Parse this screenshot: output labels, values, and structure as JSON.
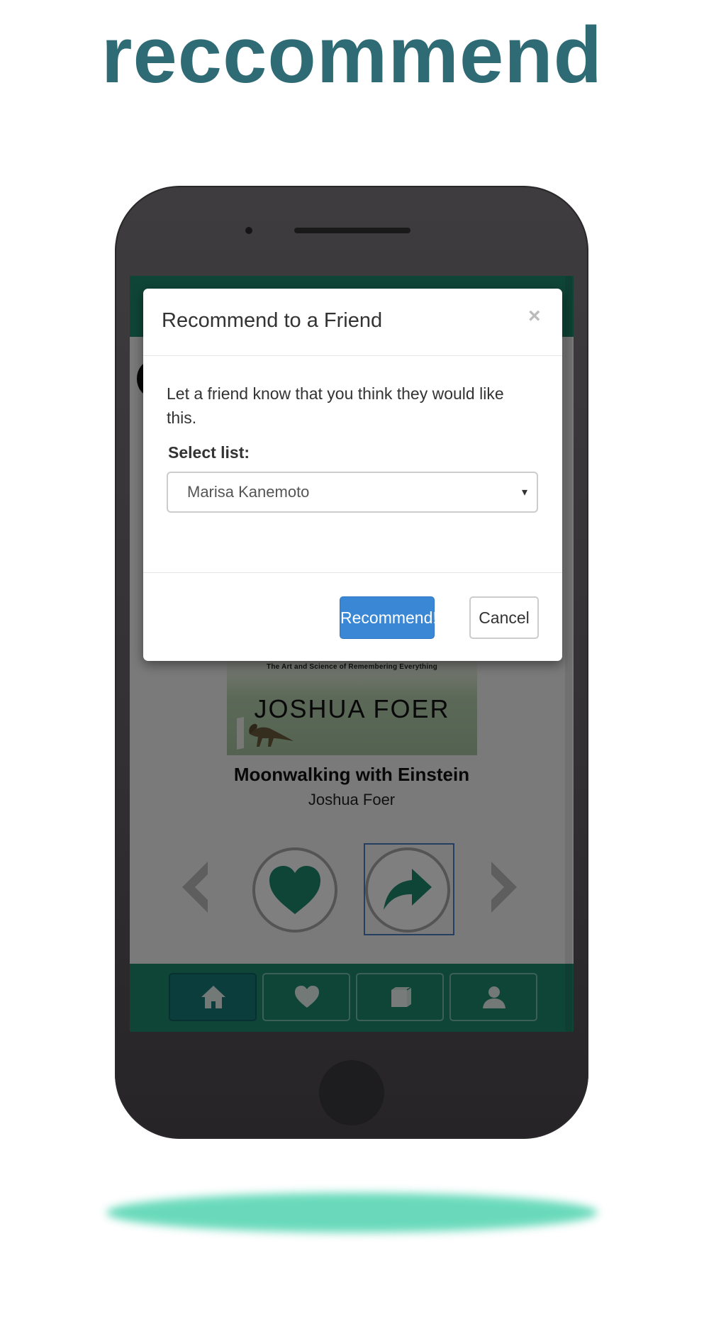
{
  "headline": "reccommend",
  "book": {
    "cover_subtitle": "The Art and Science of Remembering Everything",
    "cover_author": "JOSHUA FOER",
    "title": "Moonwalking with Einstein",
    "author": "Joshua Foer"
  },
  "modal": {
    "title": "Recommend to a Friend",
    "close_symbol": "×",
    "message": "Let a friend know that you think they would like this.",
    "select_label": "Select list:",
    "selected_friend": "Marisa Kanemoto",
    "caret": "▾",
    "recommend_label": "Recommend!",
    "cancel_label": "Cancel"
  },
  "icons": {
    "prev": "chevron-left-icon",
    "next": "chevron-right-icon",
    "like": "heart-icon",
    "share": "share-arrow-icon",
    "tabs": [
      "home-icon",
      "heart-icon",
      "book-icon",
      "user-icon"
    ]
  },
  "bottom_nav": {
    "active_tab": "home"
  },
  "colors": {
    "brand_green": "#1f8a6e",
    "headline": "#2e6b75",
    "primary_button": "#3a87d6",
    "ground_shadow": "#63d8b8"
  }
}
